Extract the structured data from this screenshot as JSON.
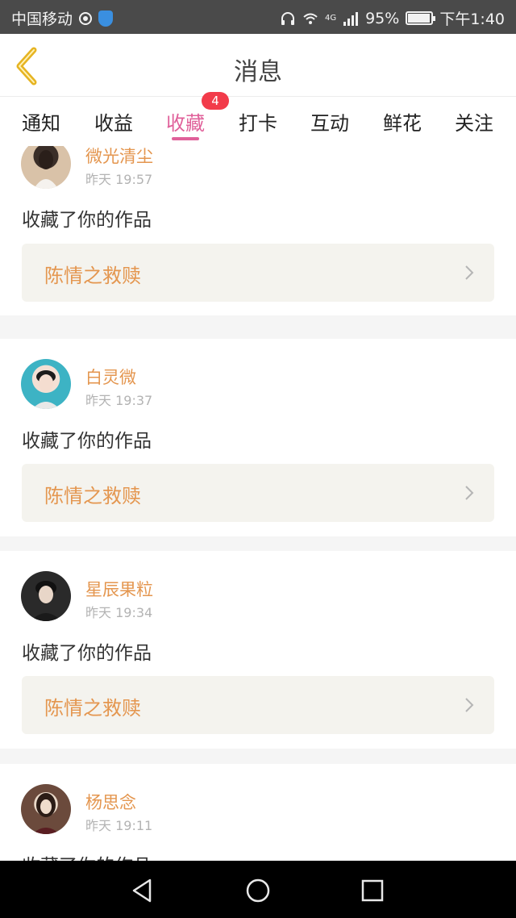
{
  "status_bar": {
    "carrier": "中国移动",
    "network": "4G",
    "battery_percent_text": "95%",
    "battery_level": 0.95,
    "time": "下午1:40"
  },
  "header": {
    "title": "消息",
    "back_icon": "chevron-left-icon",
    "back_color": "#e6b422"
  },
  "tabs": [
    {
      "label": "通知"
    },
    {
      "label": "收益"
    },
    {
      "label": "收藏",
      "active": true,
      "badge": "4"
    },
    {
      "label": "打卡"
    },
    {
      "label": "互动"
    },
    {
      "label": "鲜花"
    },
    {
      "label": "关注"
    }
  ],
  "colors": {
    "accent": "#e0609a",
    "name": "#e4964f",
    "badge": "#f23b4a",
    "work_bg": "#f4f3ee"
  },
  "feed": [
    {
      "name": "微光清尘",
      "time": "昨天 19:57",
      "action": "收藏了你的作品",
      "work": "陈情之救赎"
    },
    {
      "name": "白灵微",
      "time": "昨天 19:37",
      "action": "收藏了你的作品",
      "work": "陈情之救赎"
    },
    {
      "name": "星辰果粒",
      "time": "昨天 19:34",
      "action": "收藏了你的作品",
      "work": "陈情之救赎"
    },
    {
      "name": "杨思念",
      "time": "昨天 19:11",
      "action": "收藏了你的作品",
      "work": ""
    }
  ],
  "nav": {
    "back_icon": "triangle-back-icon",
    "home_icon": "circle-home-icon",
    "recents_icon": "square-recents-icon"
  }
}
